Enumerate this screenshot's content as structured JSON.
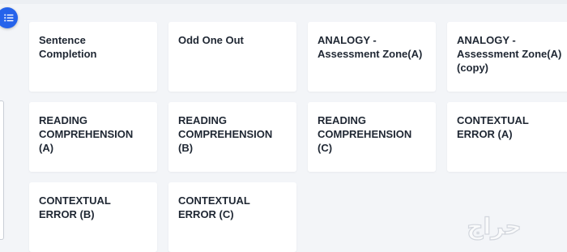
{
  "menu": {
    "icon": "list-menu-icon",
    "accent_color": "#2563eb"
  },
  "cards": [
    {
      "title": "Sentence\nCompletion"
    },
    {
      "title": "Odd One Out"
    },
    {
      "title": "ANALOGY -\nAssessment Zone(A)"
    },
    {
      "title": "ANALOGY -\nAssessment Zone(A)\n(copy)"
    },
    {
      "title": "READING\nCOMPREHENSION\n(A)"
    },
    {
      "title": "READING\nCOMPREHENSION\n(B)"
    },
    {
      "title": "READING\nCOMPREHENSION\n(C)"
    },
    {
      "title": "CONTEXTUAL\nERROR (A)"
    },
    {
      "title": "CONTEXTUAL\nERROR (B)"
    },
    {
      "title": "CONTEXTUAL\nERROR (C)"
    }
  ],
  "watermark": {
    "text": "حراج"
  }
}
